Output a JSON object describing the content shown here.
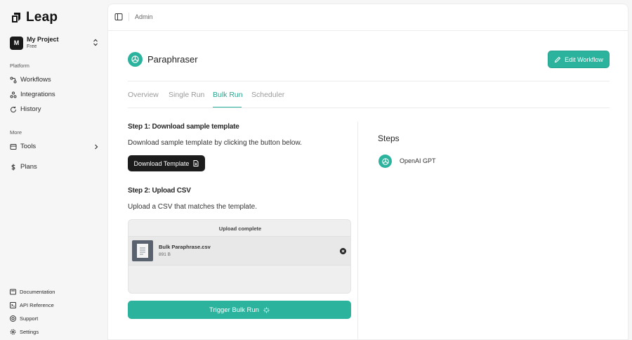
{
  "app": {
    "name": "Leap"
  },
  "project": {
    "avatar": "M",
    "name": "My Project",
    "plan": "Free"
  },
  "sidebar": {
    "platform_label": "Platform",
    "platform_items": [
      {
        "label": "Workflows",
        "icon": "workflow-icon"
      },
      {
        "label": "Integrations",
        "icon": "integrations-icon"
      },
      {
        "label": "History",
        "icon": "history-icon"
      }
    ],
    "more_label": "More",
    "more_items": [
      {
        "label": "Tools",
        "icon": "tools-icon"
      },
      {
        "label": "Plans",
        "icon": "dollar-icon"
      }
    ],
    "footer_items": [
      {
        "label": "Documentation",
        "icon": "book-icon"
      },
      {
        "label": "API Reference",
        "icon": "api-icon"
      },
      {
        "label": "Support",
        "icon": "support-icon"
      },
      {
        "label": "Settings",
        "icon": "gear-icon"
      }
    ]
  },
  "topbar": {
    "breadcrumb": "Admin"
  },
  "workflow": {
    "title": "Paraphraser",
    "edit_label": "Edit Workflow"
  },
  "tabs": [
    {
      "label": "Overview",
      "active": false
    },
    {
      "label": "Single Run",
      "active": false
    },
    {
      "label": "Bulk Run",
      "active": true
    },
    {
      "label": "Scheduler",
      "active": false
    }
  ],
  "bulk": {
    "step1_heading": "Step 1: Download sample template",
    "step1_text": "Download sample template by clicking the button below.",
    "download_label": "Download Template",
    "step2_heading": "Step 2: Upload CSV",
    "step2_text": "Upload a CSV that matches the template.",
    "upload_status": "Upload complete",
    "file": {
      "name": "Bulk Paraphrase.csv",
      "size": "891 B"
    },
    "trigger_label": "Trigger Bulk Run"
  },
  "steps": {
    "title": "Steps",
    "items": [
      {
        "label": "OpenAI GPT",
        "icon": "openai-icon"
      }
    ]
  },
  "colors": {
    "accent": "#2bb39d",
    "dark": "#1c1c1c"
  }
}
